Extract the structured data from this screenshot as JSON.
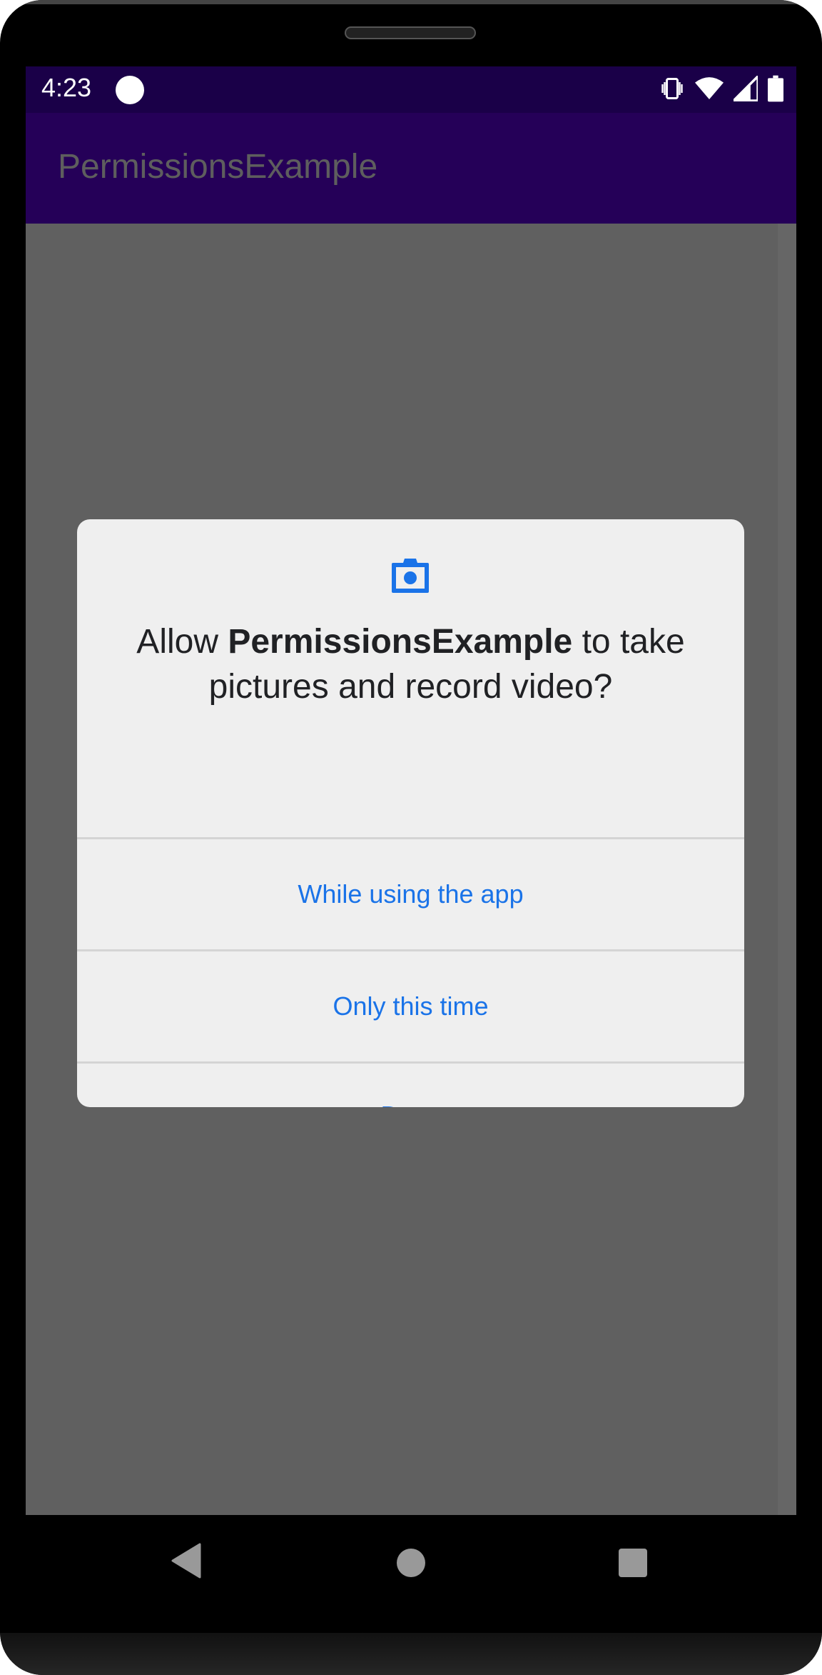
{
  "status_bar": {
    "time": "4:23",
    "icons": [
      "notification-dot-icon",
      "vibrate-icon",
      "wifi-icon",
      "cell-signal-icon",
      "battery-icon"
    ]
  },
  "app_bar": {
    "title": "PermissionsExample"
  },
  "dialog": {
    "icon": "camera-icon",
    "title_prefix": "Allow ",
    "title_app": "PermissionsExample",
    "title_suffix": " to take pictures and record video?",
    "buttons": [
      {
        "label": "While using the app"
      },
      {
        "label": "Only this time"
      },
      {
        "label": "Deny"
      }
    ]
  },
  "nav_bar": {
    "icons": [
      "back-icon",
      "home-icon",
      "recents-icon"
    ]
  },
  "colors": {
    "accent": "#1a73e8",
    "app_bar": "#250058",
    "status_bar": "#1a0048",
    "dialog_bg": "#efefef",
    "scrim": "#606060"
  }
}
